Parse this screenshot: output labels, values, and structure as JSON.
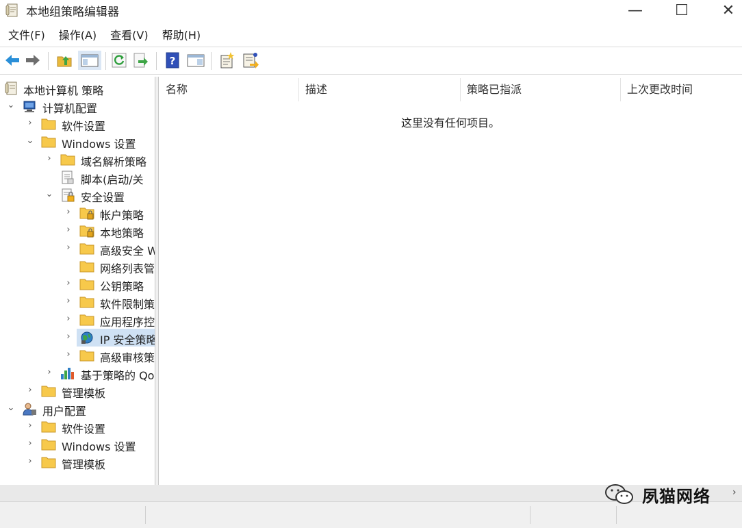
{
  "window": {
    "title": "本地组策略编辑器",
    "minimize": "—",
    "maximize": "☐",
    "close": "✕"
  },
  "menu": [
    "文件(F)",
    "操作(A)",
    "查看(V)",
    "帮助(H)"
  ],
  "toolbar": {
    "buttons": [
      "back-icon",
      "forward-icon",
      "up-folder-icon",
      "show-hide-console-tree-icon",
      "refresh-icon",
      "export-list-icon",
      "help-icon",
      "show-hide-action-pane-icon",
      "new-policy-icon",
      "properties-icon"
    ]
  },
  "tree": {
    "root": "本地计算机 策略",
    "computer_config": "计算机配置",
    "software_settings": "软件设置",
    "windows_settings": "Windows 设置",
    "dns_policy": "域名解析策略",
    "scripts": "脚本(启动/关",
    "security_settings": "安全设置",
    "account_policies": "帐户策略",
    "local_policies": "本地策略",
    "advanced_security": "高级安全 Windows",
    "network_list": "网络列表管理器",
    "public_key": "公钥策略",
    "software_restriction": "软件限制策略",
    "app_control": "应用程序控制策略",
    "ip_security": "IP 安全策略",
    "advanced_audit": "高级审核策略",
    "qos": "基于策略的 QoS",
    "admin_templates": "管理模板",
    "user_config": "用户配置",
    "user_software_settings": "软件设置",
    "user_windows_settings": "Windows 设置",
    "user_admin_templates": "管理模板"
  },
  "list": {
    "columns": [
      "名称",
      "描述",
      "策略已指派",
      "上次更改时间"
    ],
    "empty_message": "这里没有任何项目。"
  },
  "watermark": {
    "text": "夙猫网络"
  },
  "colors": {
    "folder": "#f7c94b",
    "selection": "#cfe1f4",
    "arrow_blue": "#2a8fd8"
  }
}
